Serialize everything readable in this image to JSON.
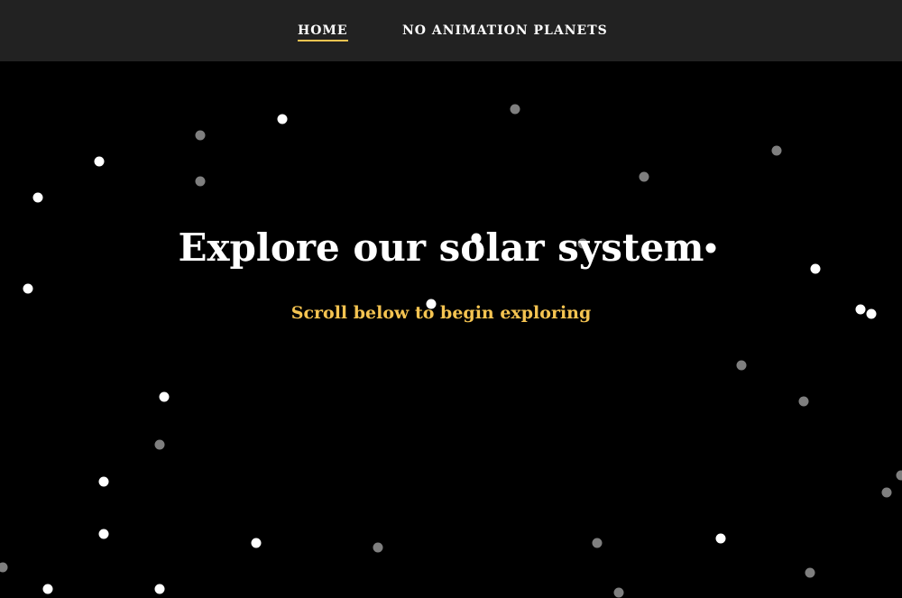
{
  "nav": {
    "items": [
      {
        "label": "HOME",
        "active": true
      },
      {
        "label": "NO ANIMATION PLANETS",
        "active": false
      }
    ]
  },
  "hero": {
    "title": "Explore our solar system",
    "subtitle": "Scroll below to begin exploring"
  },
  "colors": {
    "nav_background": "#222222",
    "page_background": "#000000",
    "text": "#ffffff",
    "accent": "#f5c451",
    "star_bright": "#ffffff",
    "star_dim": "#7f7f7f"
  }
}
